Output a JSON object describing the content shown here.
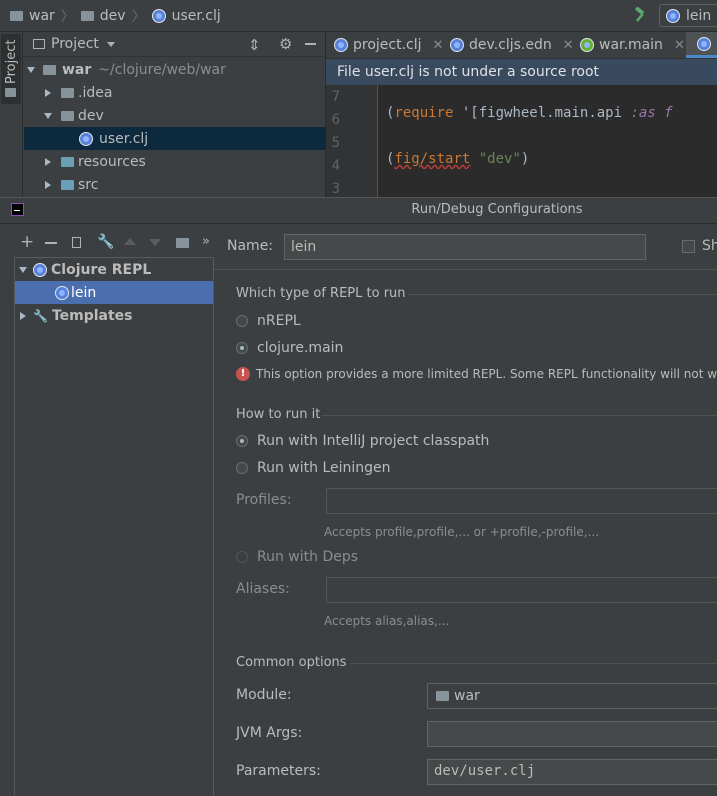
{
  "breadcrumb": {
    "items": [
      "war",
      "dev",
      "user.clj"
    ]
  },
  "toolbar": {
    "run_config": "lein",
    "build_icon": "hammer-icon"
  },
  "sidebar": {
    "project_tool_label": "Project"
  },
  "project_panel": {
    "header": "Project",
    "tree": [
      {
        "name": "war",
        "path": "~/clojure/web/war"
      },
      {
        "name": ".idea"
      },
      {
        "name": "dev"
      },
      {
        "name": "user.clj"
      },
      {
        "name": "resources"
      },
      {
        "name": "src"
      }
    ]
  },
  "editor": {
    "tabs": [
      {
        "label": "project.clj"
      },
      {
        "label": "dev.cljs.edn"
      },
      {
        "label": "war.main"
      }
    ],
    "banner": "File user.clj is not under a source root",
    "lines": [
      {
        "num": "7",
        "open": "(",
        "kw": "require",
        "rest": " '[figwheel.main.api ",
        "alias": ":as f"
      },
      {
        "num": "6"
      },
      {
        "num": "5",
        "open": "(",
        "fn": "fig/start",
        "str": " \"dev\"",
        "close": ")"
      },
      {
        "num": "4"
      },
      {
        "num": "3"
      }
    ]
  },
  "dialog": {
    "title": "Run/Debug Configurations",
    "tree": {
      "group": "Clojure REPL",
      "item": "lein",
      "templates": "Templates"
    },
    "name_label": "Name:",
    "name_value": "lein",
    "share_label": "Sh",
    "repl_type": {
      "title": "Which type of REPL to run",
      "options": [
        "nREPL",
        "clojure.main"
      ],
      "selected": "clojure.main",
      "warning": "This option provides a more limited REPL. Some REPL functionality will not work"
    },
    "how_to_run": {
      "title": "How to run it",
      "options": [
        "Run with IntelliJ project classpath",
        "Run with Leiningen"
      ],
      "selected": "Run with IntelliJ project classpath",
      "profiles_label": "Profiles:",
      "profiles_hint": "Accepts profile,profile,... or +profile,-profile,...",
      "deps_option": "Run with Deps",
      "aliases_label": "Aliases:",
      "aliases_hint": "Accepts alias,alias,..."
    },
    "common": {
      "title": "Common options",
      "module_label": "Module:",
      "module_value": "war",
      "jvm_label": "JVM Args:",
      "params_label": "Parameters:",
      "params_value": "dev/user.clj"
    }
  },
  "colors": {
    "accent": "#4b6eaf",
    "selection": "#0d293e",
    "error": "#c75450",
    "string": "#6a8759",
    "keyword": "#cc7832",
    "alias": "#9876aa"
  }
}
